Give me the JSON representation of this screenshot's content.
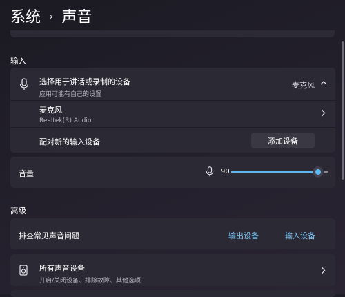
{
  "breadcrumb": {
    "parent": "系统",
    "current": "声音"
  },
  "input_section": {
    "title": "输入",
    "choose_device": {
      "title": "选择用于讲话或录制的设备",
      "subtitle": "应用可能有自己的设置",
      "selected": "麦克风"
    },
    "device": {
      "name": "麦克风",
      "detail": "Realtek(R) Audio"
    },
    "pair": {
      "label": "配对新的输入设备",
      "button": "添加设备"
    },
    "volume": {
      "label": "音量",
      "value": "90",
      "level": 0.9
    }
  },
  "advanced_section": {
    "title": "高级",
    "troubleshoot": {
      "label": "排查常见声音问题",
      "output_link": "输出设备",
      "input_link": "输入设备"
    },
    "all_devices": {
      "title": "所有声音设备",
      "subtitle": "开启/关闭设备、排除故障、其他选项"
    }
  },
  "colors": {
    "accent": "#5fb7f2",
    "card": "#2b2934",
    "link": "#7fc8f7"
  },
  "icons": [
    "chevron-right-icon",
    "microphone-icon",
    "chevron-up-icon",
    "speaker-icon"
  ]
}
